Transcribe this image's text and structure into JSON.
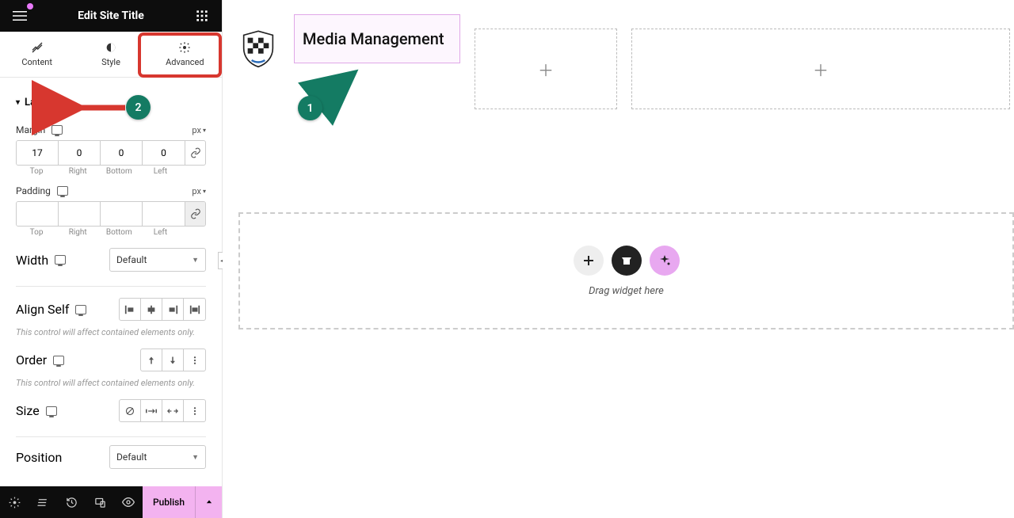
{
  "header": {
    "title": "Edit Site Title"
  },
  "tabs": {
    "content": "Content",
    "style": "Style",
    "advanced": "Advanced"
  },
  "layout": {
    "section_label": "Layout",
    "margin_label": "Margin",
    "padding_label": "Padding",
    "unit": "px",
    "margin": {
      "top": "17",
      "right": "0",
      "bottom": "0",
      "left": "0"
    },
    "padding": {
      "top": "",
      "right": "",
      "bottom": "",
      "left": ""
    },
    "dim_top": "Top",
    "dim_right": "Right",
    "dim_bottom": "Bottom",
    "dim_left": "Left",
    "width_label": "Width",
    "width_value": "Default",
    "align_label": "Align Self",
    "affect_note": "This control will affect contained elements only.",
    "order_label": "Order",
    "size_label": "Size",
    "position_label": "Position",
    "position_value": "Default"
  },
  "footer": {
    "publish": "Publish"
  },
  "canvas": {
    "title_text": "Media Management",
    "drag_text": "Drag widget here"
  },
  "annotations": {
    "badge1": "1",
    "badge2": "2"
  }
}
